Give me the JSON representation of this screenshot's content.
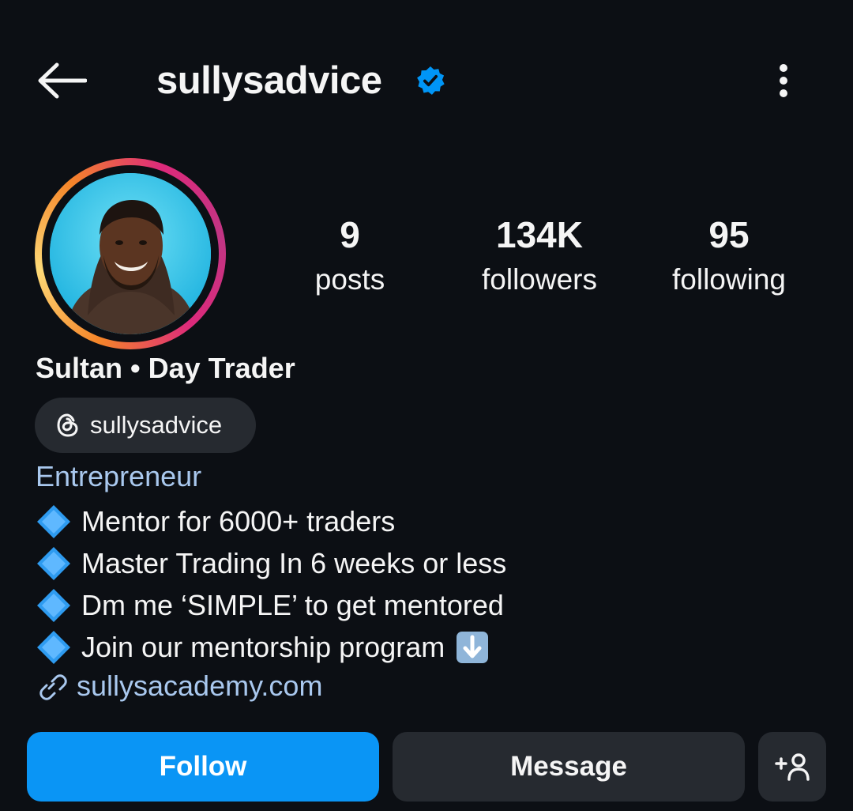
{
  "header": {
    "username": "sullysadvice",
    "verified": true,
    "back_icon": "arrow-left-icon",
    "more_icon": "more-vertical-icon"
  },
  "stats": [
    {
      "value": "9",
      "label": "posts"
    },
    {
      "value": "134K",
      "label": "followers"
    },
    {
      "value": "95",
      "label": "following"
    }
  ],
  "profile": {
    "full_name": "Sultan • Day Trader",
    "threads_handle": "sullysadvice",
    "category": "Entrepreneur",
    "bio_lines": [
      "Mentor for 6000+ traders",
      "Master Trading In 6 weeks or less",
      "Dm me ‘SIMPLE’ to get mentored",
      "Join our mentorship program"
    ],
    "link": "sullysacademy.com"
  },
  "actions": {
    "follow_label": "Follow",
    "message_label": "Message",
    "suggest_icon": "add-person-icon"
  },
  "colors": {
    "background": "#0c0f14",
    "accent": "#0a95f5",
    "link": "#a9c8ee",
    "secondary_button": "#262a30",
    "verified_badge": "#0095f6"
  }
}
